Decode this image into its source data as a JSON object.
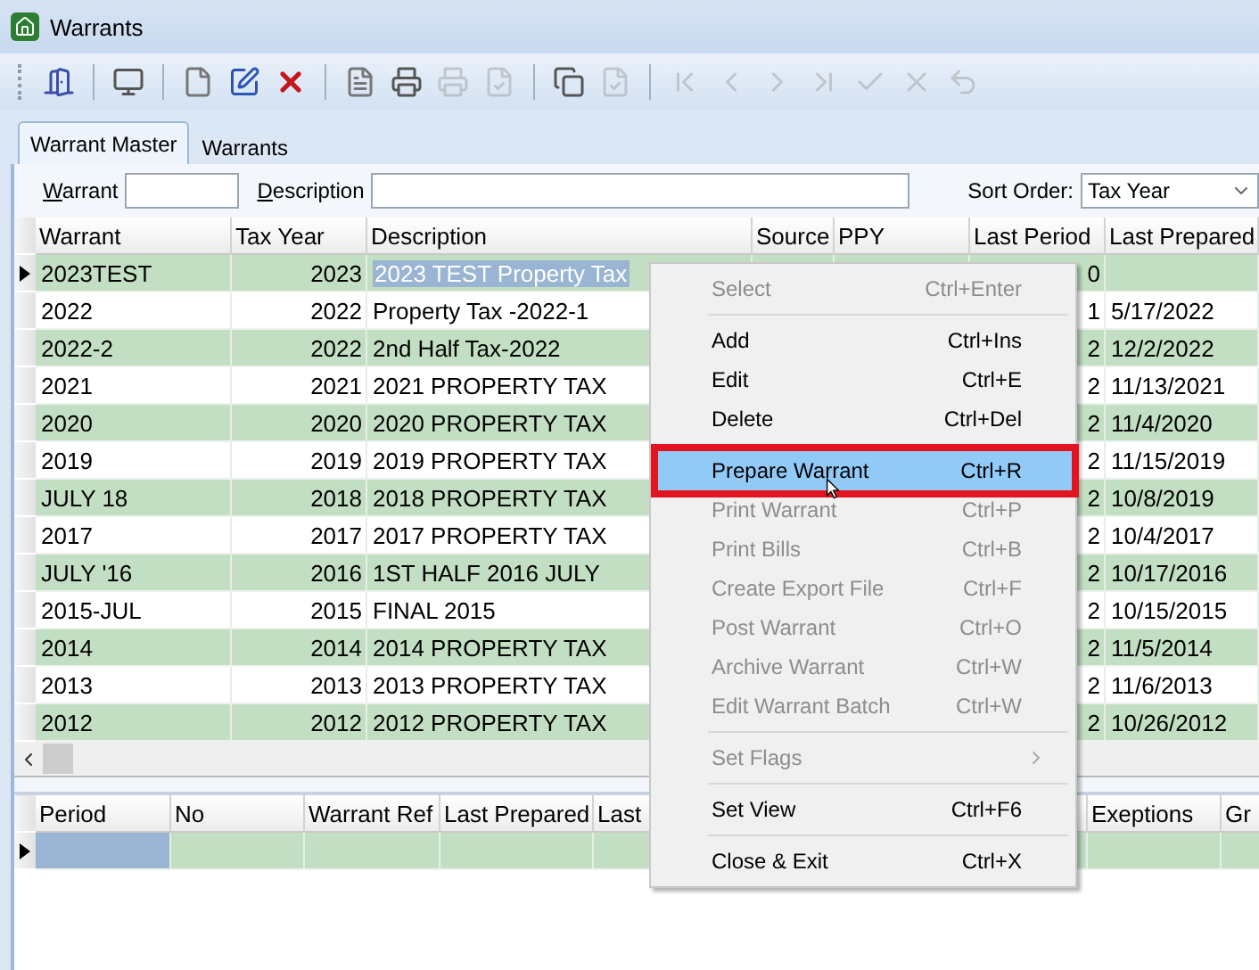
{
  "window": {
    "title": "Warrants"
  },
  "toolbar": [
    {
      "kind": "exit",
      "disabled": false
    },
    {
      "kind": "separator"
    },
    {
      "kind": "view",
      "disabled": false
    },
    {
      "kind": "separator"
    },
    {
      "kind": "new",
      "disabled": false
    },
    {
      "kind": "edit",
      "disabled": false
    },
    {
      "kind": "delete",
      "disabled": false
    },
    {
      "kind": "separator"
    },
    {
      "kind": "list",
      "disabled": false
    },
    {
      "kind": "print",
      "disabled": false
    },
    {
      "kind": "print",
      "disabled": true
    },
    {
      "kind": "approve",
      "disabled": true
    },
    {
      "kind": "separator"
    },
    {
      "kind": "copy",
      "disabled": false
    },
    {
      "kind": "approve",
      "disabled": true
    },
    {
      "kind": "separator"
    },
    {
      "kind": "first",
      "disabled": true
    },
    {
      "kind": "previous",
      "disabled": true
    },
    {
      "kind": "next",
      "disabled": true
    },
    {
      "kind": "last",
      "disabled": true
    },
    {
      "kind": "confirm",
      "disabled": true
    },
    {
      "kind": "cancel",
      "disabled": true
    },
    {
      "kind": "undo",
      "disabled": true
    }
  ],
  "tabs": [
    {
      "label": "Warrant Master",
      "selected": true
    },
    {
      "label": "Warrants",
      "selected": false
    }
  ],
  "filters": {
    "warrant_label": "Warrant",
    "description_label": "Description",
    "sort_label": "Sort Order:",
    "sort_value": "Tax Year"
  },
  "table": {
    "columns": [
      "Warrant",
      "Tax Year",
      "Description",
      "Source",
      "PPY",
      "Last Period",
      "Last Prepared"
    ],
    "rows": [
      {
        "warrant": "2023TEST",
        "tax_year": "2023",
        "description": "2023 TEST Property Tax",
        "last_period": "0",
        "selected": true
      },
      {
        "warrant": "2022",
        "tax_year": "2022",
        "description": "Property Tax -2022-1",
        "last_period": "1",
        "last_prepared": "5/17/2022",
        "selected": false
      },
      {
        "warrant": "2022-2",
        "tax_year": "2022",
        "description": "2nd Half Tax-2022",
        "last_period": "2",
        "last_prepared": "12/2/2022",
        "selected": false
      },
      {
        "warrant": "2021",
        "tax_year": "2021",
        "description": "2021 PROPERTY TAX",
        "last_period": "2",
        "last_prepared": "11/13/2021",
        "selected": false
      },
      {
        "warrant": "2020",
        "tax_year": "2020",
        "description": "2020 PROPERTY TAX",
        "last_period": "2",
        "last_prepared": "11/4/2020",
        "selected": false
      },
      {
        "warrant": "2019",
        "tax_year": "2019",
        "description": "2019 PROPERTY TAX",
        "last_period": "2",
        "last_prepared": "11/15/2019",
        "selected": false
      },
      {
        "warrant": "JULY 18",
        "tax_year": "2018",
        "description": "2018 PROPERTY TAX",
        "last_period": "2",
        "last_prepared": "10/8/2019",
        "selected": false
      },
      {
        "warrant": "2017",
        "tax_year": "2017",
        "description": "2017 PROPERTY TAX",
        "last_period": "2",
        "last_prepared": "10/4/2017",
        "selected": false
      },
      {
        "warrant": "JULY '16",
        "tax_year": "2016",
        "description": "1ST HALF 2016 JULY",
        "last_period": "2",
        "last_prepared": "10/17/2016",
        "selected": false
      },
      {
        "warrant": "2015-JUL",
        "tax_year": "2015",
        "description": "FINAL 2015",
        "last_period": "2",
        "last_prepared": "10/15/2015",
        "selected": false
      },
      {
        "warrant": "2014",
        "tax_year": "2014",
        "description": "2014 PROPERTY TAX",
        "last_period": "2",
        "last_prepared": "11/5/2014",
        "selected": false
      },
      {
        "warrant": "2013",
        "tax_year": "2013",
        "description": "2013 PROPERTY TAX",
        "last_period": "2",
        "last_prepared": "11/6/2013",
        "selected": false
      },
      {
        "warrant": "2012",
        "tax_year": "2012",
        "description": "2012 PROPERTY TAX",
        "last_period": "2",
        "last_prepared": "10/26/2012",
        "selected": false
      }
    ]
  },
  "detail_table": {
    "columns": [
      "Period",
      "No",
      "Warrant Ref",
      "Last Prepared",
      "Last",
      "Exeptions",
      "Gr"
    ],
    "rows": [
      {
        "selected": true
      }
    ]
  },
  "context_menu": [
    {
      "kind": "item",
      "label": "Select",
      "shortcut": "Ctrl+Enter",
      "disabled": true,
      "selected": false
    },
    {
      "kind": "separator"
    },
    {
      "kind": "item",
      "label": "Add",
      "shortcut": "Ctrl+Ins",
      "disabled": false,
      "selected": false
    },
    {
      "kind": "item",
      "label": "Edit",
      "shortcut": "Ctrl+E",
      "disabled": false,
      "selected": false
    },
    {
      "kind": "item",
      "label": "Delete",
      "shortcut": "Ctrl+Del",
      "disabled": false,
      "selected": false
    },
    {
      "kind": "separator"
    },
    {
      "kind": "item",
      "label": "Prepare Warrant",
      "shortcut": "Ctrl+R",
      "disabled": false,
      "selected": true,
      "outlined": true
    },
    {
      "kind": "item",
      "label": "Print Warrant",
      "shortcut": "Ctrl+P",
      "disabled": true,
      "selected": false
    },
    {
      "kind": "item",
      "label": "Print Bills",
      "shortcut": "Ctrl+B",
      "disabled": true,
      "selected": false
    },
    {
      "kind": "item",
      "label": "Create Export File",
      "shortcut": "Ctrl+F",
      "disabled": true,
      "selected": false
    },
    {
      "kind": "item",
      "label": "Post Warrant",
      "shortcut": "Ctrl+O",
      "disabled": true,
      "selected": false
    },
    {
      "kind": "item",
      "label": "Archive Warrant",
      "shortcut": "Ctrl+W",
      "disabled": true,
      "selected": false
    },
    {
      "kind": "item",
      "label": "Edit Warrant Batch",
      "shortcut": "Ctrl+W",
      "disabled": true,
      "selected": false
    },
    {
      "kind": "separator"
    },
    {
      "kind": "submenu",
      "label": "Set Flags",
      "disabled": true,
      "selected": false
    },
    {
      "kind": "separator"
    },
    {
      "kind": "item",
      "label": "Set View",
      "shortcut": "Ctrl+F6",
      "disabled": false,
      "selected": false
    },
    {
      "kind": "separator"
    },
    {
      "kind": "item",
      "label": "Close & Exit",
      "shortcut": "Ctrl+X",
      "disabled": false,
      "selected": false
    }
  ]
}
